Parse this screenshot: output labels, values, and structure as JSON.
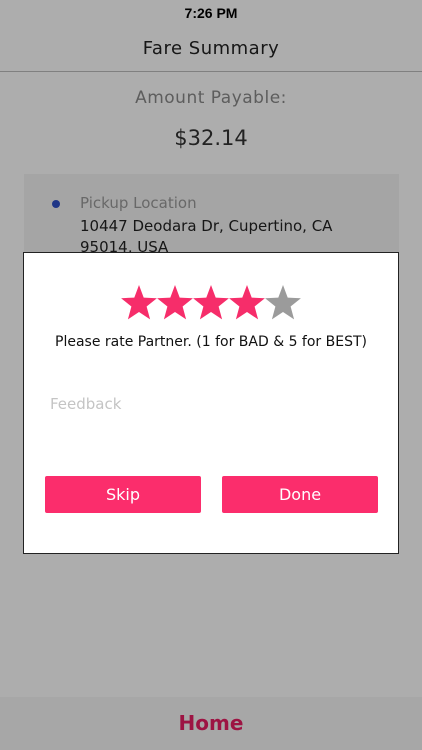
{
  "status_bar": {
    "time": "7:26 PM"
  },
  "nav": {
    "title": "Fare Summary"
  },
  "fare": {
    "label": "Amount Payable:",
    "amount": "$32.14"
  },
  "pickup": {
    "title": "Pickup Location",
    "address": "10447 Deodara Dr, Cupertino, CA 95014, USA"
  },
  "dialog": {
    "rating": {
      "value": 4,
      "max": 5
    },
    "prompt": "Please rate Partner. (1 for BAD & 5 for BEST)",
    "feedback_placeholder": "Feedback",
    "skip_label": "Skip",
    "done_label": "Done"
  },
  "footer": {
    "home_label": "Home"
  },
  "colors": {
    "accent": "#fb2d6c",
    "star_filled": "#f62d6a",
    "star_empty": "#9b9b9b",
    "pickup_dot": "#2f50c7"
  }
}
